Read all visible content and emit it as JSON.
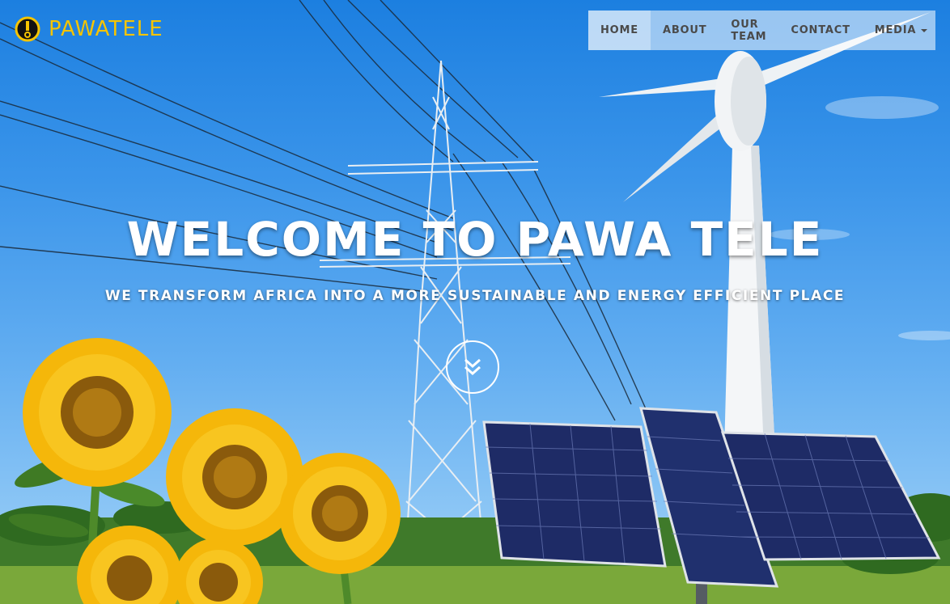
{
  "brand": {
    "name": "PAWATELE",
    "logo_icon": "power-exclamation-icon"
  },
  "nav": {
    "items": [
      {
        "label": "HOME",
        "active": true
      },
      {
        "label": "ABOUT",
        "active": false
      },
      {
        "label": "OUR TEAM",
        "active": false
      },
      {
        "label": "CONTACT",
        "active": false
      },
      {
        "label": "MEDIA",
        "active": false,
        "has_dropdown": true
      }
    ]
  },
  "hero": {
    "title": "WELCOME TO PAWA TELE",
    "subtitle": "WE TRANSFORM AFRICA INTO A MORE SUSTAINABLE AND ENERGY EFFICIENT PLACE",
    "scroll_icon": "chevron-double-down-icon"
  },
  "colors": {
    "brand_yellow": "#f5c400",
    "sky_top": "#1c7fe0",
    "sky_bottom": "#b4dbf8",
    "nav_text": "#4a4a4a"
  }
}
